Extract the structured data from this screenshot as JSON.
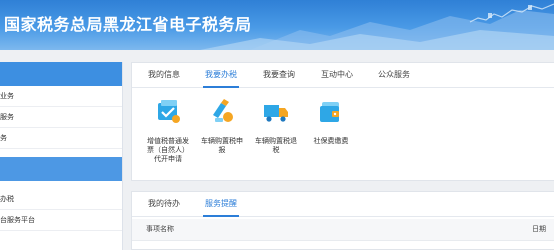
{
  "banner": {
    "title": "国家税务总局黑龙江省电子税务局"
  },
  "sidebar": {
    "items": [
      {
        "label": "业务"
      },
      {
        "label": "服务"
      },
      {
        "label": "务"
      },
      {
        "label": "办税"
      },
      {
        "label": "台服务平台"
      }
    ]
  },
  "top_panel": {
    "tabs": [
      {
        "label": "我的信息"
      },
      {
        "label": "我要办税"
      },
      {
        "label": "我要查询"
      },
      {
        "label": "互动中心"
      },
      {
        "label": "公众服务"
      }
    ],
    "active_tab": "我要办税",
    "services": [
      {
        "label": "增值税普通发票（自然人）代开申请",
        "icon": "invoice-icon"
      },
      {
        "label": "车辆购置税申报",
        "icon": "vehicle-tax-icon"
      },
      {
        "label": "车辆购置税退税",
        "icon": "truck-icon"
      },
      {
        "label": "社保费缴费",
        "icon": "wallet-icon"
      }
    ]
  },
  "bottom_panel": {
    "tabs": [
      {
        "label": "我的待办"
      },
      {
        "label": "服务提醒"
      }
    ],
    "active_tab": "服务提醒",
    "columns": [
      {
        "label": "事项名称"
      },
      {
        "label": "日期"
      }
    ]
  },
  "colors": {
    "accent": "#2c7ed8",
    "banner_top": "#2f80d6",
    "sidebar_header": "#3d8fe1"
  }
}
